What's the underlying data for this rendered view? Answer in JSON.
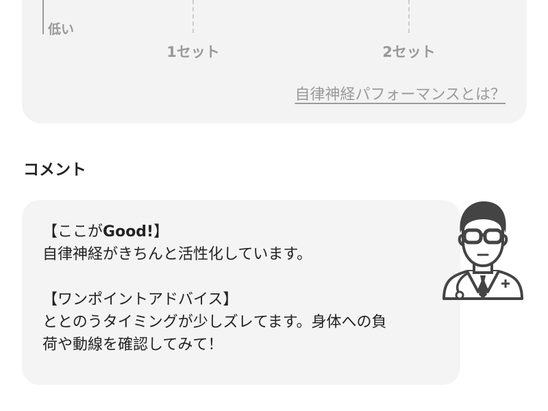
{
  "chart": {
    "low_label": "低い",
    "ticks": [
      "1セット",
      "2セット"
    ],
    "about_link": "自律神経パフォーマンスとは？"
  },
  "comment": {
    "section_title": "コメント",
    "good_heading_prefix": "【ここが",
    "good_heading_bold": "Good!",
    "good_heading_suffix": "】",
    "good_body": "自律神経がきちんと活性化しています。",
    "advice_heading": "【ワンポイントアドバイス】",
    "advice_line1": "ととのうタイミングが少しズレてます。身体への負",
    "advice_line2": "荷や動線を確認してみて！"
  },
  "avatar": {
    "icon": "doctor-avatar-icon"
  },
  "colors": {
    "card_bg": "#f3f3f3",
    "muted_text": "#999999",
    "body_text": "#222222"
  }
}
